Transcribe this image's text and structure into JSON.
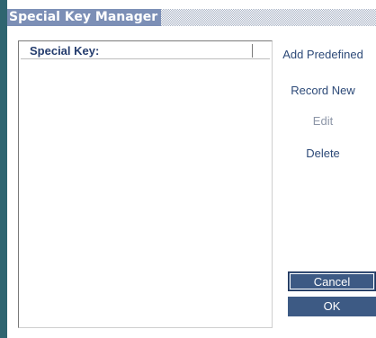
{
  "window": {
    "title": "Special Key Manager"
  },
  "key_list": {
    "header": "Special Key:",
    "items": []
  },
  "actions": {
    "add_predefined": "Add Predefined",
    "record_new": "Record New",
    "edit": "Edit",
    "delete": "Delete"
  },
  "buttons": {
    "cancel": "Cancel",
    "ok": "OK"
  },
  "colors": {
    "title_bg": "#7c8fb6",
    "accent_bar": "#2f6570",
    "button_bg": "#3d5a84",
    "link_text": "#2d4a78",
    "disabled_text": "#8d96a8"
  }
}
